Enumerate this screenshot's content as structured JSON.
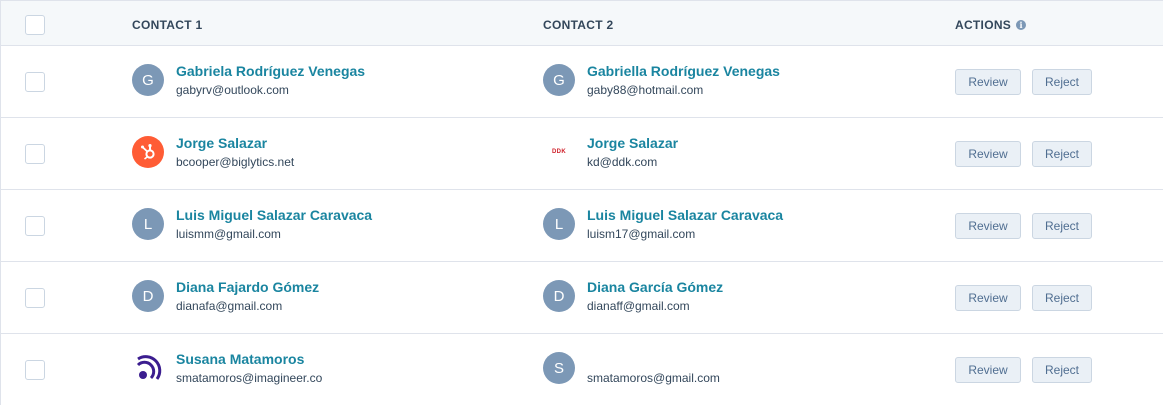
{
  "header": {
    "contact1": "CONTACT 1",
    "contact2": "CONTACT 2",
    "actions": "ACTIONS",
    "actions_info_icon": "i"
  },
  "rows": [
    {
      "c1": {
        "avatar_letter": "G",
        "name": "Gabriela Rodríguez Venegas",
        "email": "gabyrv@outlook.com"
      },
      "c2": {
        "avatar_letter": "G",
        "name": "Gabriella Rodríguez Venegas",
        "email": "gaby88@hotmail.com"
      },
      "review": "Review",
      "reject": "Reject"
    },
    {
      "c1": {
        "avatar_letter": "",
        "avatar_icon": "hubspot-logo-icon",
        "name": "Jorge Salazar",
        "email": "bcooper@biglytics.net"
      },
      "c2": {
        "avatar_letter": "",
        "avatar_icon": "ddk-logo-icon",
        "logo_text": "DDK",
        "name": "Jorge Salazar",
        "email": "kd@ddk.com"
      },
      "review": "Review",
      "reject": "Reject"
    },
    {
      "c1": {
        "avatar_letter": "L",
        "name": "Luis Miguel Salazar Caravaca",
        "email": "luismm@gmail.com"
      },
      "c2": {
        "avatar_letter": "L",
        "name": "Luis Miguel Salazar Caravaca",
        "email": "luism17@gmail.com"
      },
      "review": "Review",
      "reject": "Reject"
    },
    {
      "c1": {
        "avatar_letter": "D",
        "name": "Diana Fajardo Gómez",
        "email": "dianafa@gmail.com"
      },
      "c2": {
        "avatar_letter": "D",
        "name": "Diana García Gómez",
        "email": "dianaff@gmail.com"
      },
      "review": "Review",
      "reject": "Reject"
    },
    {
      "c1": {
        "avatar_letter": "",
        "avatar_icon": "imagineer-logo-icon",
        "name": "Susana Matamoros",
        "email": "smatamoros@imagineer.co"
      },
      "c2": {
        "avatar_letter": "S",
        "name": "",
        "email": "smatamoros@gmail.com"
      },
      "review": "Review",
      "reject": "Reject"
    }
  ],
  "colors": {
    "link": "#1a85a0",
    "avatar": "#7c98b6",
    "hubspot": "#ff5c35",
    "header_bg": "#f5f8fa",
    "border": "#dfe3eb"
  }
}
